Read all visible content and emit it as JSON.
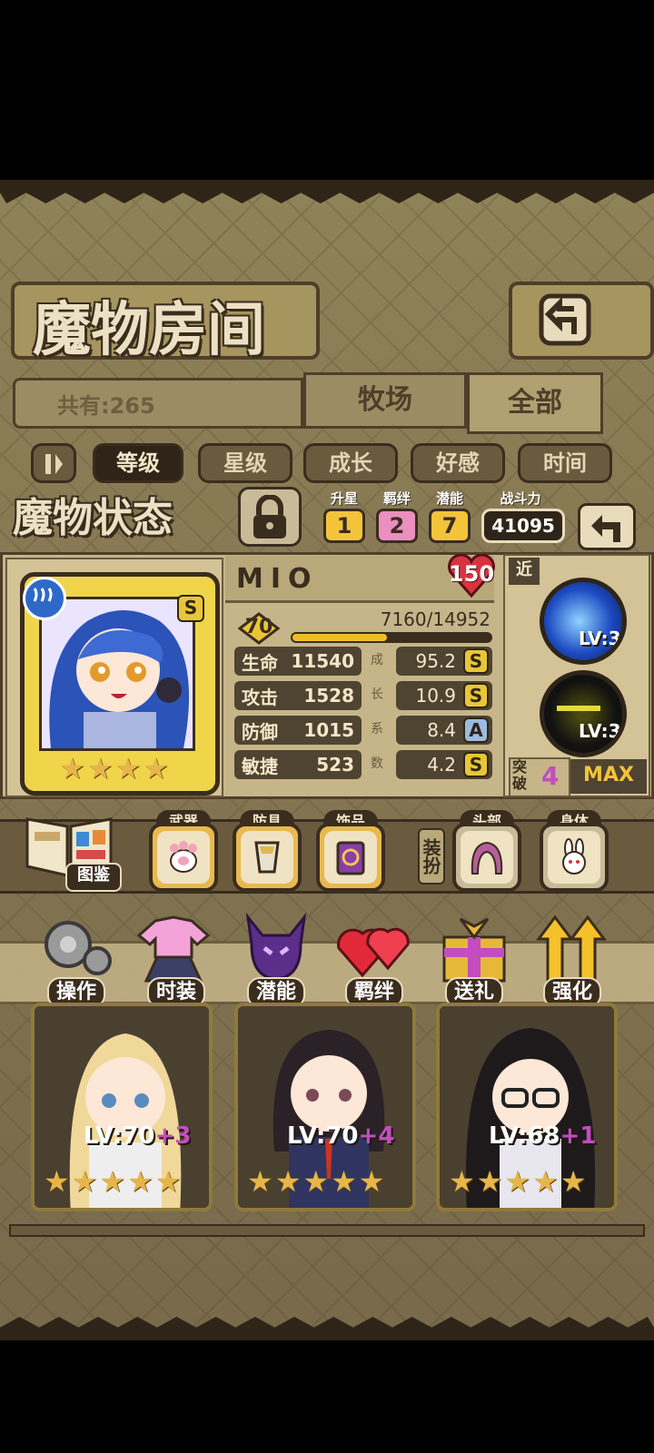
{
  "room": {
    "title": "魔物房间",
    "total": "共有:265",
    "tabs": [
      "牧场",
      "全部"
    ],
    "sort_tabs": [
      "等级",
      "星级",
      "成长",
      "好感",
      "时间"
    ]
  },
  "status": {
    "title": "魔物状态",
    "badges": [
      {
        "label": "升星",
        "value": "1"
      },
      {
        "label": "羁绊",
        "value": "2"
      },
      {
        "label": "潜能",
        "value": "7"
      }
    ],
    "power_label": "战斗力",
    "power_value": "41095"
  },
  "monster": {
    "name": "MIO",
    "level_cap": "150",
    "level": "70",
    "exp_text": "7160/14952",
    "exp_fraction": 0.479,
    "stars": "★★★★",
    "rank_grade": "S",
    "stats": [
      {
        "label": "生命",
        "value": "11540",
        "growth": "95.2",
        "grade": "S"
      },
      {
        "label": "攻击",
        "value": "1528",
        "growth": "10.9",
        "grade": "S"
      },
      {
        "label": "防御",
        "value": "1015",
        "growth": "8.4",
        "grade": "A"
      },
      {
        "label": "敏捷",
        "value": "523",
        "growth": "4.2",
        "grade": "S"
      }
    ],
    "growth_vertical": [
      "成",
      "长",
      "系",
      "数"
    ]
  },
  "skills": {
    "range_label": "近",
    "items": [
      {
        "level": "LV:3"
      },
      {
        "level": "LV:3"
      }
    ],
    "breakthrough_label": "突破",
    "breakthrough_value": "4",
    "max_label": "MAX"
  },
  "equipment": {
    "codex_label": "图鉴",
    "slots": [
      {
        "label": "武器"
      },
      {
        "label": "防具"
      },
      {
        "label": "饰品"
      }
    ],
    "outfit_label": "装扮",
    "outfit_slots": [
      {
        "label": "头部"
      },
      {
        "label": "身体"
      }
    ]
  },
  "actions": [
    "操作",
    "时装",
    "潜能",
    "羁绊",
    "送礼",
    "强化"
  ],
  "cards": [
    {
      "level": "LV:70",
      "plus": "+3",
      "stars": "★★★★★"
    },
    {
      "level": "LV:70",
      "plus": "+4",
      "stars": "★★★★★"
    },
    {
      "level": "LV:68",
      "plus": "+1",
      "stars": "★★★★★"
    }
  ],
  "colors": {
    "gold": "#e9c637",
    "pink": "#ea8fbf",
    "dark_brown": "#3a2d1e",
    "parchment": "#c6b589"
  }
}
